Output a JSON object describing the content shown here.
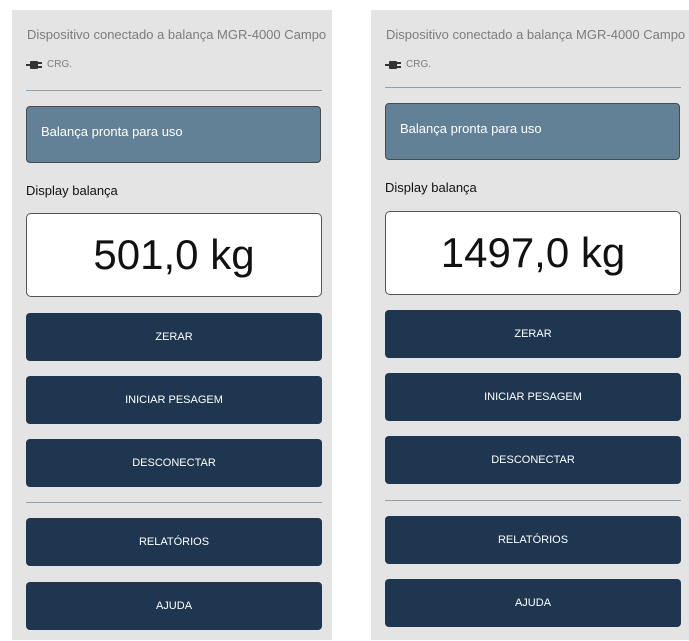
{
  "screens": [
    {
      "device_text": "Dispositivo conectado a balança MGR-4000 Campo",
      "connection_label": "CRG.",
      "connection_icon": "plug-icon",
      "status_message": "Balança pronta para uso",
      "display_label": "Display balança",
      "weight_display": "501,0 kg",
      "buttons": {
        "zero": "ZERAR",
        "start_weighing": "INICIAR PESAGEM",
        "disconnect": "DESCONECTAR",
        "reports": "RELATÓRIOS",
        "help": "AJUDA"
      }
    },
    {
      "device_text": "Dispositivo conectado a balança MGR-4000 Campo",
      "connection_label": "CRG.",
      "connection_icon": "plug-icon",
      "status_message": "Balança pronta para uso",
      "display_label": "Display balança",
      "weight_display": "1497,0 kg",
      "buttons": {
        "zero": "ZERAR",
        "start_weighing": "INICIAR PESAGEM",
        "disconnect": "DESCONECTAR",
        "reports": "RELATÓRIOS",
        "help": "AJUDA"
      }
    }
  ],
  "colors": {
    "screen_background": "#e4e4e4",
    "status_box": "#628196",
    "button": "#1e3650",
    "divider": "#8aa0b3"
  }
}
